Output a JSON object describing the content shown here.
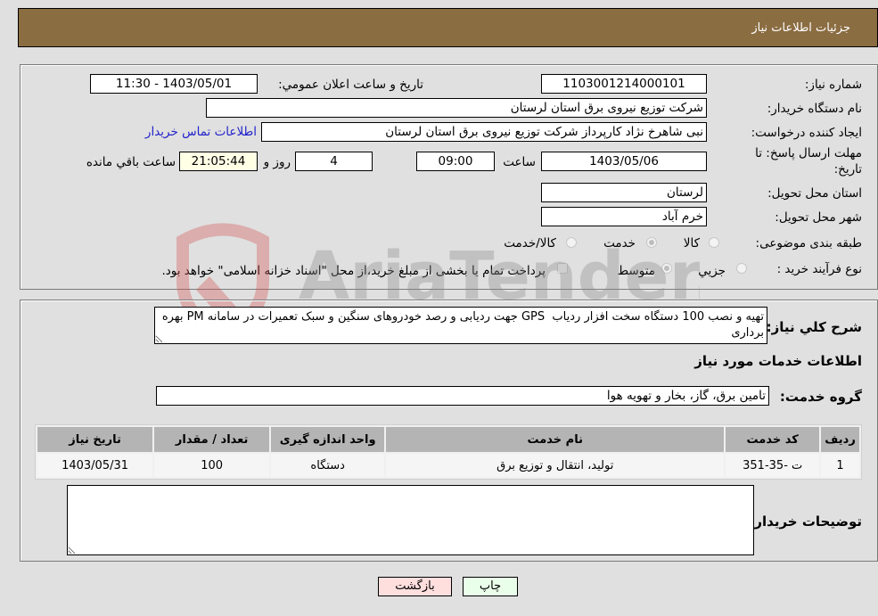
{
  "header": {
    "title": "جزئیات اطلاعات نیاز"
  },
  "form": {
    "need_number": {
      "label": "شماره نیاز:",
      "value": "1103001214000101"
    },
    "announce_datetime": {
      "label": "تاریخ و ساعت اعلان عمومي:",
      "value": "1403/05/01 - 11:30"
    },
    "buyer_org": {
      "label": "نام دستگاه خریدار:",
      "value": "شرکت توزیع نیروی برق استان لرستان"
    },
    "requester": {
      "label": "ایجاد کننده درخواست:",
      "value": "نبی شاهرخ نژاد کارپرداز شرکت توزیع نیروی برق استان لرستان"
    },
    "buyer_contact_link": "اطلاعات تماس خریدار",
    "deadline": {
      "label_line1": "مهلت ارسال پاسخ: تا",
      "label_line2": "تاریخ:",
      "date": "1403/05/06",
      "time_label": "ساعت",
      "time": "09:00",
      "days": "4",
      "days_label": "روز و",
      "remaining": "21:05:44",
      "remaining_label": "ساعت باقي مانده"
    },
    "delivery_province": {
      "label": "استان محل تحویل:",
      "value": "لرستان"
    },
    "delivery_city": {
      "label": "شهر محل تحویل:",
      "value": "خرم آباد"
    },
    "category": {
      "label": "طبقه بندی موضوعی:",
      "options": [
        "کالا",
        "خدمت",
        "کالا/خدمت"
      ],
      "selected": "خدمت"
    },
    "purchase_process": {
      "label": "نوع فرآیند خرید :",
      "options": [
        "جزيي",
        "متوسط"
      ],
      "selected": "متوسط",
      "treasury_note": "پرداخت تمام یا بخشی از مبلغ خرید،از محل \"اسناد خزانه اسلامی\" خواهد بود.",
      "treasury_checked": false
    }
  },
  "details": {
    "description_label": "شرح کلي نیاز:",
    "description": "تهیه و نصب 100 دستگاه سخت افزار ردیاب  GPS جهت ردیابی و رصد خودروهای سنگین و سبک تعمیرات در سامانه PM بهره برداری",
    "services_heading": "اطلاعات خدمات مورد نیاز",
    "service_group_label": "گروه خدمت:",
    "service_group": "تامین برق، گاز، بخار و تهویه هوا",
    "table": {
      "headers": [
        "ردیف",
        "کد خدمت",
        "نام خدمت",
        "واحد اندازه گیری",
        "تعداد / مقدار",
        "تاریخ نیاز"
      ],
      "rows": [
        [
          "1",
          "ت -35-351",
          "تولید، انتقال و توزیع برق",
          "دستگاه",
          "100",
          "1403/05/31"
        ]
      ]
    },
    "buyer_notes_label": "توضیحات خریدار:",
    "buyer_notes": ""
  },
  "buttons": {
    "print": "چاپ",
    "back": "بازگشت"
  },
  "colors": {
    "header_bg": "#8b6d42",
    "print_bg": "#eaffea",
    "back_bg": "#ffdede",
    "link": "#2222cc"
  }
}
